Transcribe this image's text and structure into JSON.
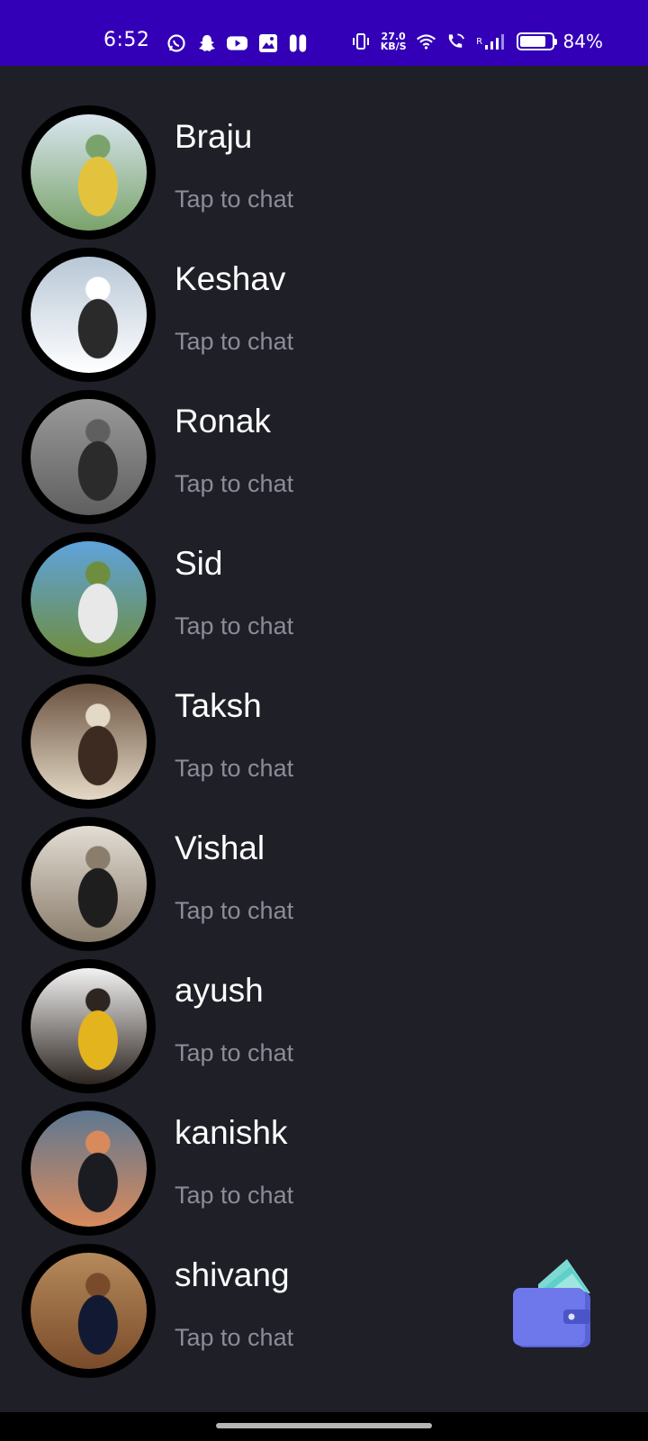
{
  "status_bar": {
    "time": "6:52",
    "net_speed_value": "27.0",
    "net_speed_unit": "KB/S",
    "roaming": "R",
    "battery_percent_text": "84%",
    "battery_level": 0.84,
    "icons": [
      "whatsapp-icon",
      "snapchat-icon",
      "youtube-icon",
      "gallery-icon",
      "pause-icon",
      "vibrate-icon",
      "wifi-icon",
      "wifi-call-icon",
      "signal-icon",
      "battery-icon"
    ]
  },
  "contacts": [
    {
      "name": "Braju",
      "subtitle": "Tap to chat",
      "avatar_colors": [
        "#d9e6ef",
        "#7aa36b",
        "#e3c33d"
      ]
    },
    {
      "name": "Keshav",
      "subtitle": "Tap to chat",
      "avatar_colors": [
        "#b8c7d6",
        "#ffffff",
        "#2a2a2a"
      ]
    },
    {
      "name": "Ronak",
      "subtitle": "Tap to chat",
      "avatar_colors": [
        "#9a9a9a",
        "#5f5f5f",
        "#2b2b2b"
      ]
    },
    {
      "name": "Sid",
      "subtitle": "Tap to chat",
      "avatar_colors": [
        "#5ea3dc",
        "#6f8d3f",
        "#e8e8e8"
      ]
    },
    {
      "name": "Taksh",
      "subtitle": "Tap to chat",
      "avatar_colors": [
        "#6b5240",
        "#e4d9c6",
        "#3d2b22"
      ]
    },
    {
      "name": "Vishal",
      "subtitle": "Tap to chat",
      "avatar_colors": [
        "#e3ddd4",
        "#8a7d6c",
        "#1e1e1e"
      ]
    },
    {
      "name": "ayush",
      "subtitle": "Tap to chat",
      "avatar_colors": [
        "#f2f2f2",
        "#2d2520",
        "#e3b41d"
      ]
    },
    {
      "name": "kanishk",
      "subtitle": "Tap to chat",
      "avatar_colors": [
        "#5e7891",
        "#d98a5c",
        "#1b1b22"
      ]
    },
    {
      "name": "shivang",
      "subtitle": "Tap to chat",
      "avatar_colors": [
        "#b58a5b",
        "#7a4b2a",
        "#121a33"
      ]
    }
  ],
  "fab": {
    "icon": "wallet-icon",
    "colors": {
      "wallet": "#6770e6",
      "cards": "#5fd0c9"
    }
  }
}
